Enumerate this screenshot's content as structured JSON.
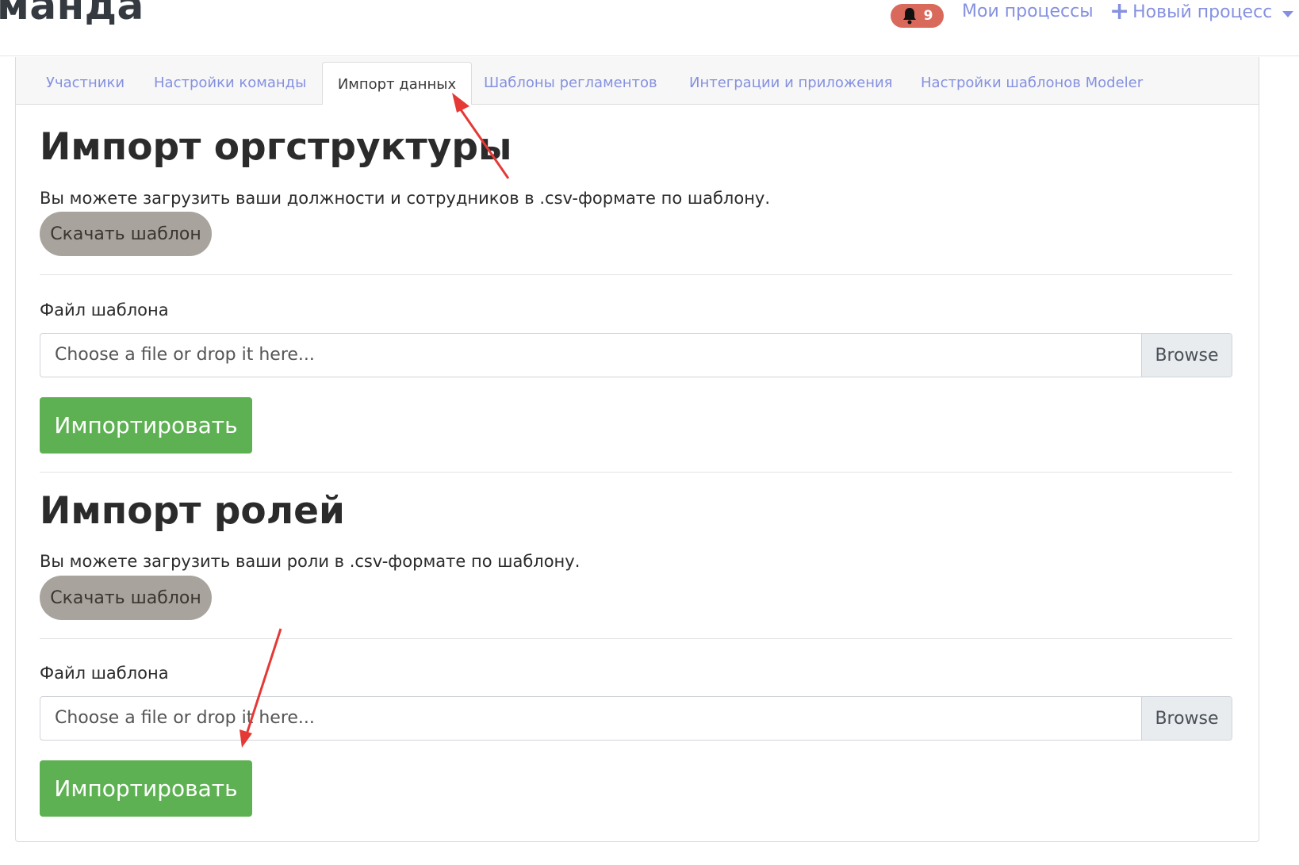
{
  "header": {
    "brand_fragment": "манда",
    "notifications_count": "9",
    "my_processes_label": "Мои процессы",
    "new_process_label": "Новый процесс"
  },
  "tabs": [
    {
      "label": "Участники"
    },
    {
      "label": "Настройки команды"
    },
    {
      "label": "Импорт данных",
      "active": true
    },
    {
      "label": "Шаблоны регламентов"
    },
    {
      "label": "Интеграции и приложения"
    },
    {
      "label": "Настройки шаблонов Modeler"
    }
  ],
  "orgstructure": {
    "title": "Импорт оргструктуры",
    "description": "Вы можете загрузить ваши должности и сотрудников в .csv-формате по шаблону.",
    "download_label": "Скачать шаблон",
    "file_label": "Файл шаблона",
    "file_placeholder": "Choose a file or drop it here...",
    "browse_label": "Browse",
    "import_label": "Импортировать"
  },
  "roles": {
    "title": "Импорт ролей",
    "description": "Вы можете загрузить ваши роли в .csv-формате по шаблону.",
    "download_label": "Скачать шаблон",
    "file_label": "Файл шаблона",
    "file_placeholder": "Choose a file or drop it here...",
    "browse_label": "Browse",
    "import_label": "Импортировать"
  },
  "colors": {
    "accent_link": "#8591e0",
    "import_button": "#5db152",
    "template_button": "#a8a39d",
    "notification_badge": "#d9695b",
    "annotation_arrow": "#e53935"
  }
}
